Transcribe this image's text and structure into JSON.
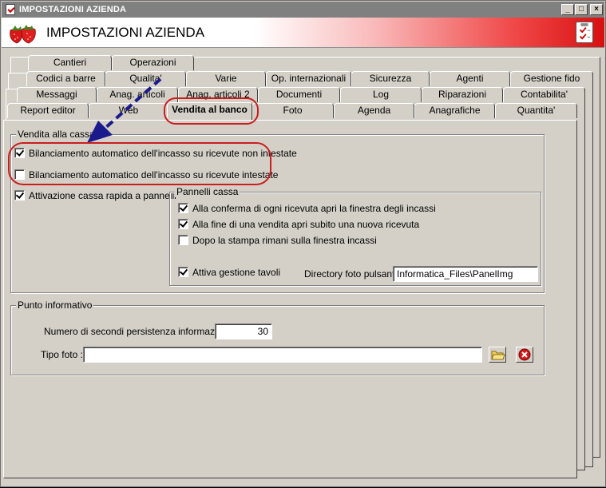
{
  "window": {
    "title": "IMPOSTAZIONI AZIENDA",
    "minimize_label": "_",
    "maximize_label": "□",
    "close_label": "×"
  },
  "header": {
    "title": "IMPOSTAZIONI AZIENDA",
    "logo_icon": "strawberry-icon",
    "checklist_icon": "clipboard-check-icon"
  },
  "tabs": {
    "row1": [
      "Cantieri",
      "Operazioni"
    ],
    "row2": [
      "Codici a barre",
      "Qualita'",
      "Varie",
      "Op. internazionali",
      "Sicurezza",
      "Agenti",
      "Gestione fido"
    ],
    "row3": [
      "Messaggi",
      "Anag. articoli",
      "Anag. articoli 2",
      "Documenti",
      "Log",
      "Riparazioni",
      "Contabilita'"
    ],
    "row4": [
      "Report editor",
      "Web",
      "Vendita al banco",
      "Foto",
      "Agenda",
      "Anagrafiche",
      "Quantita'"
    ],
    "active": "Vendita al banco"
  },
  "vendita_cassa": {
    "legend": "Vendita alla cassa",
    "opt1": {
      "label": "Bilanciamento automatico dell'incasso su ricevute non intestate",
      "checked": true
    },
    "opt2": {
      "label": "Bilanciamento automatico dell'incasso su ricevute intestate",
      "checked": false
    },
    "opt3": {
      "label": "Attivazione cassa rapida a pannelli",
      "checked": true
    }
  },
  "pannelli_cassa": {
    "legend": "Pannelli cassa",
    "opt1": {
      "label": "Alla conferma di ogni ricevuta apri la finestra degli incassi",
      "checked": true
    },
    "opt2": {
      "label": "Alla fine di una vendita apri subito una nuova ricevuta",
      "checked": true
    },
    "opt3": {
      "label": "Dopo la stampa rimani sulla finestra incassi",
      "checked": false
    },
    "opt4": {
      "label": "Attiva gestione tavoli",
      "checked": true
    },
    "directory_label": "Directory foto pulsanti :",
    "directory_value": "Informatica_Files\\PanelImg"
  },
  "punto_informativo": {
    "legend": "Punto informativo",
    "seconds_label": "Numero di secondi persistenza informazioni :",
    "seconds_value": "30",
    "tipo_foto_label": "Tipo foto :",
    "tipo_foto_value": "",
    "browse_icon": "folder-icon",
    "clear_icon": "delete-icon"
  },
  "colors": {
    "face": "#d4d0c8",
    "title_inactive": "#808080",
    "highlight_ring": "#c81e1e",
    "arrow": "#1a1a8c"
  }
}
